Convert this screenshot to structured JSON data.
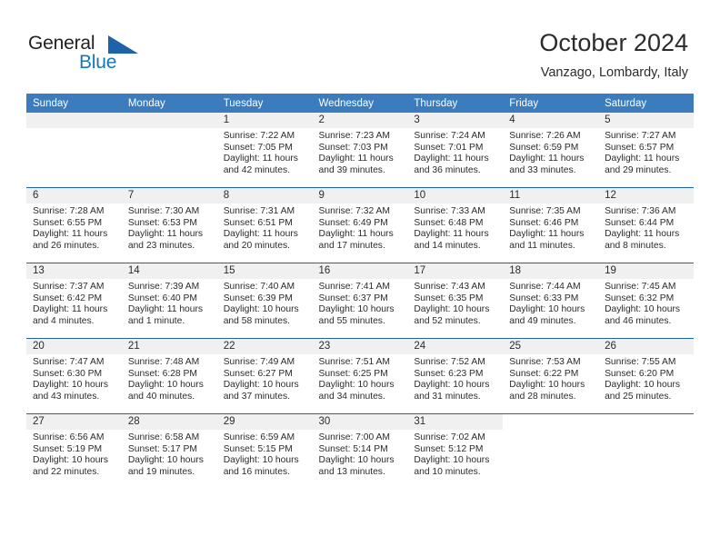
{
  "brand": {
    "name_part1": "General",
    "name_part2": "Blue",
    "logo_icon": "triangle-logo-icon"
  },
  "header": {
    "title": "October 2024",
    "subtitle": "Vanzago, Lombardy, Italy"
  },
  "colors": {
    "header_blue": "#3a7cbe",
    "rule_blue": "#1e63a8",
    "brand_blue": "#1278be",
    "day_band_gray": "#f0f0f0",
    "text": "#2b2b2b"
  },
  "calendar": {
    "weekday_headers": [
      "Sunday",
      "Monday",
      "Tuesday",
      "Wednesday",
      "Thursday",
      "Friday",
      "Saturday"
    ],
    "weeks": [
      [
        {
          "day": "",
          "sunrise": "",
          "sunset": "",
          "daylight_line1": "",
          "daylight_line2": ""
        },
        {
          "day": "",
          "sunrise": "",
          "sunset": "",
          "daylight_line1": "",
          "daylight_line2": ""
        },
        {
          "day": "1",
          "sunrise": "Sunrise: 7:22 AM",
          "sunset": "Sunset: 7:05 PM",
          "daylight_line1": "Daylight: 11 hours",
          "daylight_line2": "and 42 minutes."
        },
        {
          "day": "2",
          "sunrise": "Sunrise: 7:23 AM",
          "sunset": "Sunset: 7:03 PM",
          "daylight_line1": "Daylight: 11 hours",
          "daylight_line2": "and 39 minutes."
        },
        {
          "day": "3",
          "sunrise": "Sunrise: 7:24 AM",
          "sunset": "Sunset: 7:01 PM",
          "daylight_line1": "Daylight: 11 hours",
          "daylight_line2": "and 36 minutes."
        },
        {
          "day": "4",
          "sunrise": "Sunrise: 7:26 AM",
          "sunset": "Sunset: 6:59 PM",
          "daylight_line1": "Daylight: 11 hours",
          "daylight_line2": "and 33 minutes."
        },
        {
          "day": "5",
          "sunrise": "Sunrise: 7:27 AM",
          "sunset": "Sunset: 6:57 PM",
          "daylight_line1": "Daylight: 11 hours",
          "daylight_line2": "and 29 minutes."
        }
      ],
      [
        {
          "day": "6",
          "sunrise": "Sunrise: 7:28 AM",
          "sunset": "Sunset: 6:55 PM",
          "daylight_line1": "Daylight: 11 hours",
          "daylight_line2": "and 26 minutes."
        },
        {
          "day": "7",
          "sunrise": "Sunrise: 7:30 AM",
          "sunset": "Sunset: 6:53 PM",
          "daylight_line1": "Daylight: 11 hours",
          "daylight_line2": "and 23 minutes."
        },
        {
          "day": "8",
          "sunrise": "Sunrise: 7:31 AM",
          "sunset": "Sunset: 6:51 PM",
          "daylight_line1": "Daylight: 11 hours",
          "daylight_line2": "and 20 minutes."
        },
        {
          "day": "9",
          "sunrise": "Sunrise: 7:32 AM",
          "sunset": "Sunset: 6:49 PM",
          "daylight_line1": "Daylight: 11 hours",
          "daylight_line2": "and 17 minutes."
        },
        {
          "day": "10",
          "sunrise": "Sunrise: 7:33 AM",
          "sunset": "Sunset: 6:48 PM",
          "daylight_line1": "Daylight: 11 hours",
          "daylight_line2": "and 14 minutes."
        },
        {
          "day": "11",
          "sunrise": "Sunrise: 7:35 AM",
          "sunset": "Sunset: 6:46 PM",
          "daylight_line1": "Daylight: 11 hours",
          "daylight_line2": "and 11 minutes."
        },
        {
          "day": "12",
          "sunrise": "Sunrise: 7:36 AM",
          "sunset": "Sunset: 6:44 PM",
          "daylight_line1": "Daylight: 11 hours",
          "daylight_line2": "and 8 minutes."
        }
      ],
      [
        {
          "day": "13",
          "sunrise": "Sunrise: 7:37 AM",
          "sunset": "Sunset: 6:42 PM",
          "daylight_line1": "Daylight: 11 hours",
          "daylight_line2": "and 4 minutes."
        },
        {
          "day": "14",
          "sunrise": "Sunrise: 7:39 AM",
          "sunset": "Sunset: 6:40 PM",
          "daylight_line1": "Daylight: 11 hours",
          "daylight_line2": "and 1 minute."
        },
        {
          "day": "15",
          "sunrise": "Sunrise: 7:40 AM",
          "sunset": "Sunset: 6:39 PM",
          "daylight_line1": "Daylight: 10 hours",
          "daylight_line2": "and 58 minutes."
        },
        {
          "day": "16",
          "sunrise": "Sunrise: 7:41 AM",
          "sunset": "Sunset: 6:37 PM",
          "daylight_line1": "Daylight: 10 hours",
          "daylight_line2": "and 55 minutes."
        },
        {
          "day": "17",
          "sunrise": "Sunrise: 7:43 AM",
          "sunset": "Sunset: 6:35 PM",
          "daylight_line1": "Daylight: 10 hours",
          "daylight_line2": "and 52 minutes."
        },
        {
          "day": "18",
          "sunrise": "Sunrise: 7:44 AM",
          "sunset": "Sunset: 6:33 PM",
          "daylight_line1": "Daylight: 10 hours",
          "daylight_line2": "and 49 minutes."
        },
        {
          "day": "19",
          "sunrise": "Sunrise: 7:45 AM",
          "sunset": "Sunset: 6:32 PM",
          "daylight_line1": "Daylight: 10 hours",
          "daylight_line2": "and 46 minutes."
        }
      ],
      [
        {
          "day": "20",
          "sunrise": "Sunrise: 7:47 AM",
          "sunset": "Sunset: 6:30 PM",
          "daylight_line1": "Daylight: 10 hours",
          "daylight_line2": "and 43 minutes."
        },
        {
          "day": "21",
          "sunrise": "Sunrise: 7:48 AM",
          "sunset": "Sunset: 6:28 PM",
          "daylight_line1": "Daylight: 10 hours",
          "daylight_line2": "and 40 minutes."
        },
        {
          "day": "22",
          "sunrise": "Sunrise: 7:49 AM",
          "sunset": "Sunset: 6:27 PM",
          "daylight_line1": "Daylight: 10 hours",
          "daylight_line2": "and 37 minutes."
        },
        {
          "day": "23",
          "sunrise": "Sunrise: 7:51 AM",
          "sunset": "Sunset: 6:25 PM",
          "daylight_line1": "Daylight: 10 hours",
          "daylight_line2": "and 34 minutes."
        },
        {
          "day": "24",
          "sunrise": "Sunrise: 7:52 AM",
          "sunset": "Sunset: 6:23 PM",
          "daylight_line1": "Daylight: 10 hours",
          "daylight_line2": "and 31 minutes."
        },
        {
          "day": "25",
          "sunrise": "Sunrise: 7:53 AM",
          "sunset": "Sunset: 6:22 PM",
          "daylight_line1": "Daylight: 10 hours",
          "daylight_line2": "and 28 minutes."
        },
        {
          "day": "26",
          "sunrise": "Sunrise: 7:55 AM",
          "sunset": "Sunset: 6:20 PM",
          "daylight_line1": "Daylight: 10 hours",
          "daylight_line2": "and 25 minutes."
        }
      ],
      [
        {
          "day": "27",
          "sunrise": "Sunrise: 6:56 AM",
          "sunset": "Sunset: 5:19 PM",
          "daylight_line1": "Daylight: 10 hours",
          "daylight_line2": "and 22 minutes."
        },
        {
          "day": "28",
          "sunrise": "Sunrise: 6:58 AM",
          "sunset": "Sunset: 5:17 PM",
          "daylight_line1": "Daylight: 10 hours",
          "daylight_line2": "and 19 minutes."
        },
        {
          "day": "29",
          "sunrise": "Sunrise: 6:59 AM",
          "sunset": "Sunset: 5:15 PM",
          "daylight_line1": "Daylight: 10 hours",
          "daylight_line2": "and 16 minutes."
        },
        {
          "day": "30",
          "sunrise": "Sunrise: 7:00 AM",
          "sunset": "Sunset: 5:14 PM",
          "daylight_line1": "Daylight: 10 hours",
          "daylight_line2": "and 13 minutes."
        },
        {
          "day": "31",
          "sunrise": "Sunrise: 7:02 AM",
          "sunset": "Sunset: 5:12 PM",
          "daylight_line1": "Daylight: 10 hours",
          "daylight_line2": "and 10 minutes."
        },
        {
          "day": "",
          "sunrise": "",
          "sunset": "",
          "daylight_line1": "",
          "daylight_line2": ""
        },
        {
          "day": "",
          "sunrise": "",
          "sunset": "",
          "daylight_line1": "",
          "daylight_line2": ""
        }
      ]
    ]
  }
}
